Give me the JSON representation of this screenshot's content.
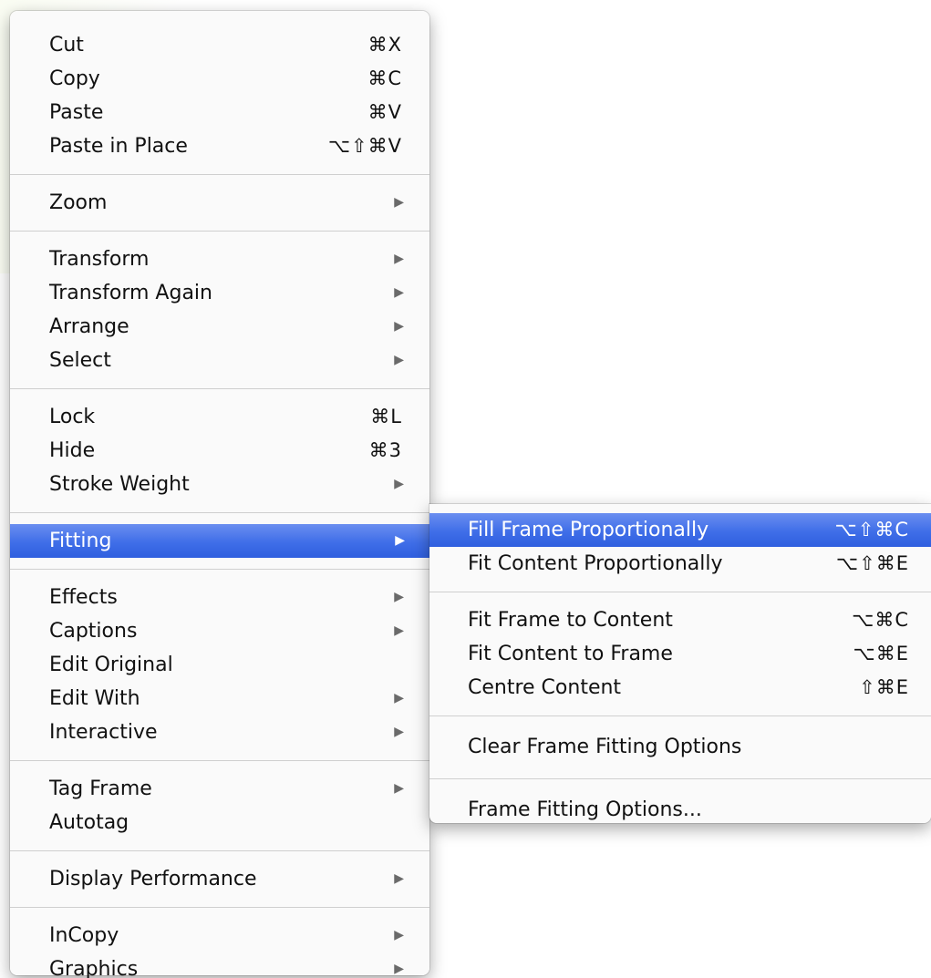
{
  "context_menu": {
    "groups": [
      {
        "items": [
          {
            "label": "Cut",
            "shortcut": "⌘X"
          },
          {
            "label": "Copy",
            "shortcut": "⌘C"
          },
          {
            "label": "Paste",
            "shortcut": "⌘V"
          },
          {
            "label": "Paste in Place",
            "shortcut": "⌥⇧⌘V"
          }
        ]
      },
      {
        "items": [
          {
            "label": "Zoom",
            "submenu": true
          }
        ]
      },
      {
        "items": [
          {
            "label": "Transform",
            "submenu": true
          },
          {
            "label": "Transform Again",
            "submenu": true
          },
          {
            "label": "Arrange",
            "submenu": true
          },
          {
            "label": "Select",
            "submenu": true
          }
        ]
      },
      {
        "items": [
          {
            "label": "Lock",
            "shortcut": "⌘L"
          },
          {
            "label": "Hide",
            "shortcut": "⌘3"
          },
          {
            "label": "Stroke Weight",
            "submenu": true
          }
        ]
      },
      {
        "items": [
          {
            "label": "Fitting",
            "submenu": true,
            "highlighted": true
          }
        ]
      },
      {
        "items": [
          {
            "label": "Effects",
            "submenu": true
          },
          {
            "label": "Captions",
            "submenu": true
          },
          {
            "label": "Edit Original"
          },
          {
            "label": "Edit With",
            "submenu": true
          },
          {
            "label": "Interactive",
            "submenu": true
          }
        ]
      },
      {
        "items": [
          {
            "label": "Tag Frame",
            "submenu": true
          },
          {
            "label": "Autotag"
          }
        ]
      },
      {
        "items": [
          {
            "label": "Display Performance",
            "submenu": true
          }
        ]
      },
      {
        "items": [
          {
            "label": "InCopy",
            "submenu": true
          },
          {
            "label": "Graphics",
            "submenu": true
          }
        ]
      }
    ],
    "arrow_glyph": "▶"
  },
  "fitting_submenu": {
    "groups": [
      {
        "items": [
          {
            "label": "Fill Frame Proportionally",
            "shortcut": "⌥⇧⌘C",
            "highlighted": true
          },
          {
            "label": "Fit Content Proportionally",
            "shortcut": "⌥⇧⌘E"
          }
        ]
      },
      {
        "items": [
          {
            "label": "Fit Frame to Content",
            "shortcut": "⌥⌘C"
          },
          {
            "label": "Fit Content to Frame",
            "shortcut": "⌥⌘E"
          },
          {
            "label": "Centre Content",
            "shortcut": "⇧⌘E"
          }
        ]
      },
      {
        "items": [
          {
            "label": "Clear Frame Fitting Options"
          }
        ]
      },
      {
        "items": [
          {
            "label": "Frame Fitting Options..."
          }
        ]
      }
    ]
  },
  "colors": {
    "highlight": "#3f6ee8",
    "menu_background": "#fafafa",
    "separator": "#cfcfcf"
  }
}
